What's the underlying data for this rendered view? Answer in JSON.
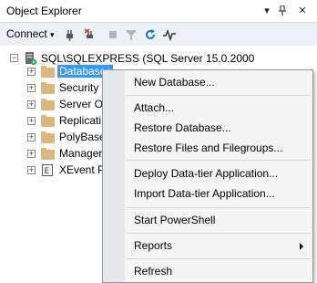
{
  "window": {
    "title": "Object Explorer",
    "controls": [
      "dropdown-icon",
      "pin-icon",
      "close-icon"
    ]
  },
  "toolbar": {
    "connect_label": "Connect",
    "icons": [
      "connect-dropdown-icon",
      "connect-plug-icon",
      "disconnect-plug-icon",
      "stop-icon",
      "filter-icon",
      "refresh-icon",
      "activity-monitor-icon"
    ]
  },
  "tree": {
    "server": "SQL\\SQLEXPRESS (SQL Server 15.0.2000",
    "items": [
      {
        "label": "Databases",
        "selected": true
      },
      {
        "label": "Security"
      },
      {
        "label": "Server Ob"
      },
      {
        "label": "Replicati"
      },
      {
        "label": "PolyBase"
      },
      {
        "label": "Manager"
      },
      {
        "label": "XEvent P"
      }
    ]
  },
  "context_menu": {
    "items": [
      "New Database...",
      "Attach...",
      "Restore Database...",
      "Restore Files and Filegroups...",
      "Deploy Data-tier Application...",
      "Import Data-tier Application...",
      "Start PowerShell",
      "Reports",
      "Refresh"
    ]
  },
  "colors": {
    "selection": "#3399ff",
    "folder": "#dcb67a",
    "toolbar_bg": "#eef0f7",
    "menu_bg": "#f5f5f5",
    "menu_gutter": "#e7e8ec"
  }
}
